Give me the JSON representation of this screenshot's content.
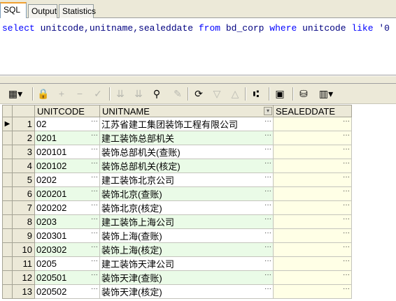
{
  "tabs": [
    {
      "label": "SQL",
      "active": true
    },
    {
      "label": "Output",
      "active": false
    },
    {
      "label": "Statistics",
      "active": false
    }
  ],
  "editor": {
    "sql": [
      {
        "text": "select",
        "kw": true
      },
      {
        "text": " unitcode,unitname,sealeddate ",
        "kw": false
      },
      {
        "text": "from",
        "kw": true
      },
      {
        "text": " bd_corp ",
        "kw": false
      },
      {
        "text": "where",
        "kw": true
      },
      {
        "text": " unitcode ",
        "kw": false
      },
      {
        "text": "like",
        "kw": true
      },
      {
        "text": " '0",
        "kw": false
      }
    ]
  },
  "toolbar": {
    "buttons": [
      {
        "name": "grid-mode-icon",
        "glyph": "▦▾",
        "enabled": true
      },
      {
        "name": "lock-icon",
        "glyph": "🔒",
        "enabled": true
      },
      {
        "name": "add-record-icon",
        "glyph": "+",
        "enabled": false
      },
      {
        "name": "delete-record-icon",
        "glyph": "−",
        "enabled": false
      },
      {
        "name": "post-changes-icon",
        "glyph": "✓",
        "enabled": false
      },
      {
        "name": "query-by-example-icon",
        "glyph": "⇊",
        "enabled": false
      },
      {
        "name": "clear-query-icon",
        "glyph": "⇊",
        "enabled": false
      },
      {
        "name": "find-icon",
        "glyph": "⚲",
        "enabled": true
      },
      {
        "name": "clear-icon",
        "glyph": "✎",
        "enabled": false
      },
      {
        "name": "refresh-icon",
        "glyph": "⟳",
        "enabled": true
      },
      {
        "name": "next-page-icon",
        "glyph": "▽",
        "enabled": false
      },
      {
        "name": "previous-page-icon",
        "glyph": "△",
        "enabled": false
      },
      {
        "name": "tree-icon",
        "glyph": "⑆",
        "enabled": true
      },
      {
        "name": "save-icon",
        "glyph": "▣",
        "enabled": true
      },
      {
        "name": "export-icon",
        "glyph": "⛁",
        "enabled": true
      },
      {
        "name": "chart-icon",
        "glyph": "▥▾",
        "enabled": true
      }
    ]
  },
  "grid": {
    "columns": [
      "UNITCODE",
      "UNITNAME",
      "SEALEDDATE"
    ],
    "ellipsis": "···",
    "current_indicator": "▶",
    "rows": [
      {
        "n": "1",
        "code": "02",
        "name": "江苏省建工集团装饰工程有限公司",
        "sealed": ""
      },
      {
        "n": "2",
        "code": "0201",
        "name": "建工装饰总部机关",
        "sealed": ""
      },
      {
        "n": "3",
        "code": "020101",
        "name": "装饰总部机关(查账)",
        "sealed": ""
      },
      {
        "n": "4",
        "code": "020102",
        "name": "装饰总部机关(核定)",
        "sealed": ""
      },
      {
        "n": "5",
        "code": "0202",
        "name": "建工装饰北京公司",
        "sealed": ""
      },
      {
        "n": "6",
        "code": "020201",
        "name": "装饰北京(查账)",
        "sealed": ""
      },
      {
        "n": "7",
        "code": "020202",
        "name": "装饰北京(核定)",
        "sealed": ""
      },
      {
        "n": "8",
        "code": "0203",
        "name": "建工装饰上海公司",
        "sealed": ""
      },
      {
        "n": "9",
        "code": "020301",
        "name": "装饰上海(查账)",
        "sealed": ""
      },
      {
        "n": "10",
        "code": "020302",
        "name": "装饰上海(核定)",
        "sealed": ""
      },
      {
        "n": "11",
        "code": "0205",
        "name": "建工装饰天津公司",
        "sealed": ""
      },
      {
        "n": "12",
        "code": "020501",
        "name": "装饰天津(查账)",
        "sealed": ""
      },
      {
        "n": "13",
        "code": "020502",
        "name": "装饰天津(核定)",
        "sealed": ""
      }
    ]
  }
}
